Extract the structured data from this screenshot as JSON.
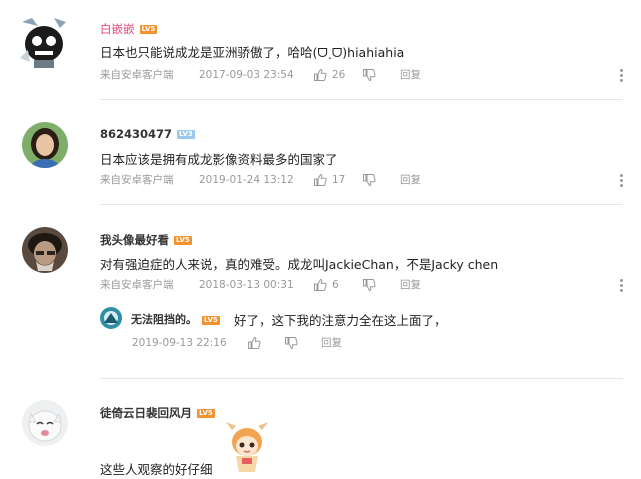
{
  "comments": [
    {
      "username": "白嵌嵌",
      "level": "LV5",
      "text": "日本也只能说成龙是亚洲骄傲了，哈哈(ᗜ˰ᗜ)hiahiahia",
      "source": "来自安卓客户端",
      "time": "2017-09-03 23:54",
      "likes": "26",
      "reply_label": "回复"
    },
    {
      "username": "862430477",
      "level": "LV3",
      "text": "日本应该是拥有成龙影像资料最多的国家了",
      "source": "来自安卓客户端",
      "time": "2019-01-24 13:12",
      "likes": "17",
      "reply_label": "回复"
    },
    {
      "username": "我头像最好看",
      "level": "LV5",
      "text": "对有强迫症的人来说，真的难受。成龙叫JackieChan，不是Jacky chen",
      "source": "来自安卓客户端",
      "time": "2018-03-13 00:31",
      "likes": "6",
      "reply_label": "回复",
      "reply": {
        "username": "无法阻挡的。",
        "level": "LV5",
        "text": "好了，这下我的注意力全在这上面了，",
        "time": "2019-09-13 22:16",
        "reply_label": "回复"
      }
    },
    {
      "username": "徒倚云日裴回风月",
      "level": "LV5",
      "text": "这些人观察的好仔细"
    }
  ],
  "colors": {
    "pink_username": "#e5477d",
    "level_badge": "#f2932f",
    "level_badge_blue": "#9cc8ee",
    "meta_text": "#999999",
    "divider": "#e6e6e6"
  },
  "icons": [
    "thumb-up-icon",
    "thumb-down-icon",
    "more-icon"
  ]
}
